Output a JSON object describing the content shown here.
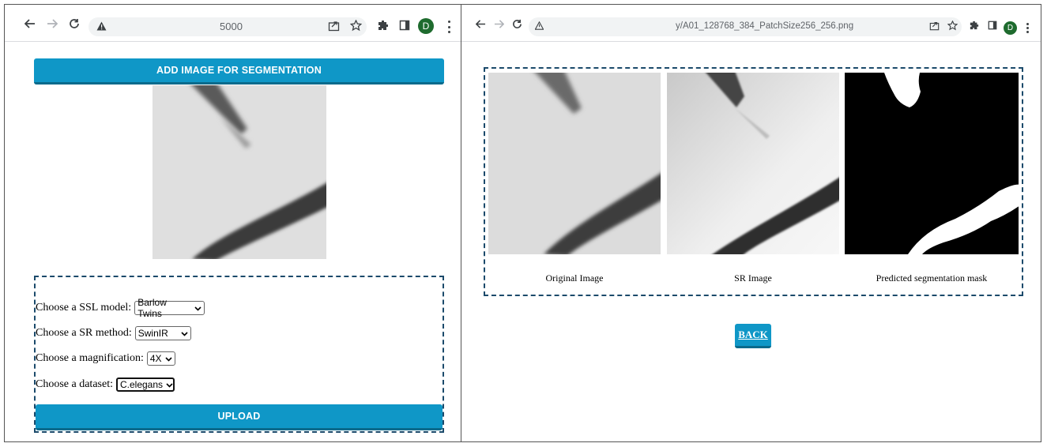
{
  "left_window": {
    "address_bar": {
      "url": "5000"
    },
    "profile_initial": "D",
    "add_image_button": "ADD IMAGE FOR SEGMENTATION",
    "form": {
      "ssl_label": "Choose a SSL model:",
      "ssl_value": "Barlow Twins",
      "sr_label": "Choose a SR method:",
      "sr_value": "SwinIR",
      "mag_label": "Choose a magnification:",
      "mag_value": "4X",
      "dataset_label": "Choose a dataset:",
      "dataset_value": "C.elegans",
      "upload_button": "UPLOAD"
    }
  },
  "right_window": {
    "address_bar": {
      "url": "y/A01_128768_384_PatchSize256_256.png"
    },
    "profile_initial": "D",
    "captions": [
      "Original Image",
      "SR Image",
      "Predicted segmentation mask"
    ],
    "back_button": "BACK"
  },
  "colors": {
    "accent": "#0f97c7",
    "dashed_border": "#1b4a6b",
    "avatar": "#1e6b2e"
  }
}
